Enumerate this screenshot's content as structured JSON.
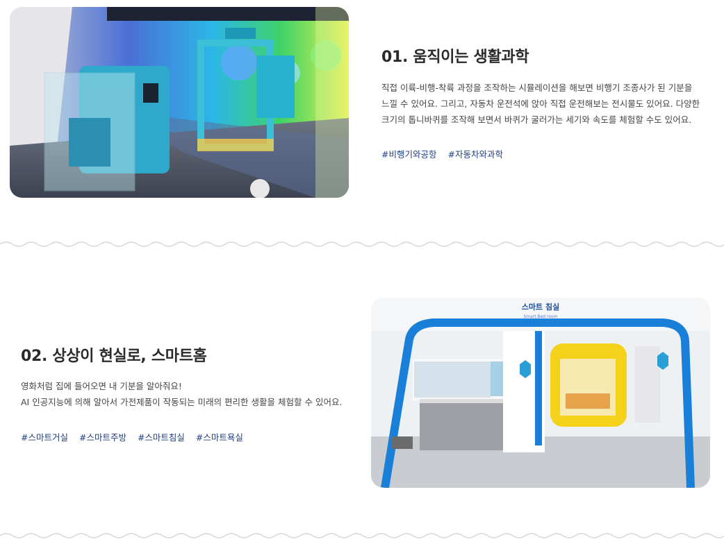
{
  "colors": {
    "accent": "#1f3f82",
    "title": "#2a2a2a",
    "divider": "#d9d9d9"
  },
  "sections": [
    {
      "title": "01. 움직이는 생활과학",
      "desc_lines": [
        "직접 이륙-비행-착륙 과정을 조작하는 시뮬레이션을 해보면 비행기 조종사가 된 기분을",
        "느낄 수 있어요. 그리고, 자동차 운전석에 앉아 직접 운전해보는 전시물도 있어요. 다양한",
        "크기의 톱니바퀴를 조작해 보면서 바퀴가 굴러가는 세기와 속도를 체험할 수도 있어요."
      ],
      "tags": [
        "#비행기와공항",
        "#자동차와과학"
      ],
      "image_alt": "비행 시뮬레이션 전시물 사진"
    },
    {
      "title": "02. 상상이 현실로, 스마트홈",
      "desc_lines": [
        "영화처럼 집에 들어오면 내 기분을 알아줘요!",
        "AI 인공지능에 의해 알아서 가전제품이 작동되는 미래의 편리한 생활을 체험할 수 있어요."
      ],
      "tags": [
        "#스마트거실",
        "#스마트주방",
        "#스마트침실",
        "#스마트욕실"
      ],
      "image_sign_title": "스마트 침실",
      "image_sign_sub": "Smart Bed room",
      "image_alt": "스마트 침실 전시관 사진"
    }
  ]
}
